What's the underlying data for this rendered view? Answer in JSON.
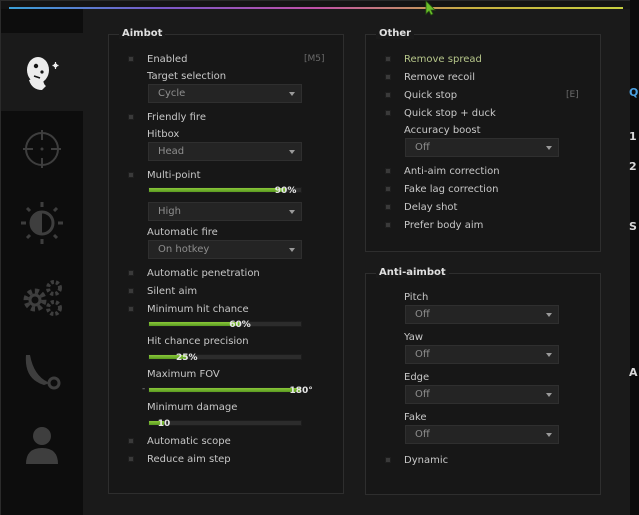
{
  "sidebar": {
    "tabs": [
      {
        "name": "rage-tab",
        "icon": "headshot-icon",
        "active": true
      },
      {
        "name": "legit-tab",
        "icon": "crosshair-icon"
      },
      {
        "name": "visuals-tab",
        "icon": "brightness-icon"
      },
      {
        "name": "misc-tab",
        "icon": "gears-icon"
      },
      {
        "name": "skins-tab",
        "icon": "karambit-icon"
      },
      {
        "name": "players-tab",
        "icon": "user-icon"
      }
    ]
  },
  "aimbot": {
    "title": "Aimbot",
    "enabled": {
      "label": "Enabled",
      "key": "[M5]"
    },
    "target_selection": {
      "label": "Target selection",
      "value": "Cycle"
    },
    "friendly_fire": {
      "label": "Friendly fire"
    },
    "hitbox": {
      "label": "Hitbox",
      "value": "Head"
    },
    "multipoint": {
      "label": "Multi-point",
      "slider": 90,
      "slider_text": "90%",
      "select": "High"
    },
    "automatic_fire": {
      "label": "Automatic fire",
      "value": "On hotkey"
    },
    "automatic_penetration": {
      "label": "Automatic penetration"
    },
    "silent_aim": {
      "label": "Silent aim"
    },
    "min_hit_chance": {
      "label": "Minimum hit chance",
      "slider": 60,
      "slider_text": "60%"
    },
    "hit_chance_precision": {
      "label": "Hit chance precision",
      "slider": 25,
      "slider_text": "25%"
    },
    "max_fov": {
      "label": "Maximum FOV",
      "slider": 180,
      "slider_max": 180,
      "slider_text": "180°",
      "prefix": "-"
    },
    "min_damage": {
      "label": "Minimum damage",
      "slider": 10,
      "slider_max": 100,
      "slider_text": "10"
    },
    "automatic_scope": {
      "label": "Automatic scope"
    },
    "reduce_aim_step": {
      "label": "Reduce aim step"
    }
  },
  "other": {
    "title": "Other",
    "remove_spread": {
      "label": "Remove spread"
    },
    "remove_recoil": {
      "label": "Remove recoil"
    },
    "quick_stop": {
      "label": "Quick stop",
      "key": "[E]"
    },
    "quick_stop_duck": {
      "label": "Quick stop + duck"
    },
    "accuracy_boost": {
      "label": "Accuracy boost",
      "value": "Off"
    },
    "anti_aim_correction": {
      "label": "Anti-aim correction"
    },
    "fake_lag_correction": {
      "label": "Fake lag correction"
    },
    "delay_shot": {
      "label": "Delay shot"
    },
    "prefer_body_aim": {
      "label": "Prefer body aim"
    }
  },
  "anti_aimbot": {
    "title": "Anti-aimbot",
    "pitch": {
      "label": "Pitch",
      "value": "Off"
    },
    "yaw": {
      "label": "Yaw",
      "value": "Off"
    },
    "edge": {
      "label": "Edge",
      "value": "Off"
    },
    "fake": {
      "label": "Fake",
      "value": "Off"
    },
    "dynamic": {
      "label": "Dynamic"
    }
  },
  "background_edge": [
    "Q",
    "1",
    "2",
    "S",
    "A"
  ],
  "colors": {
    "accent_green": "#7ab82e",
    "highlight_label": "#b6c68a"
  }
}
